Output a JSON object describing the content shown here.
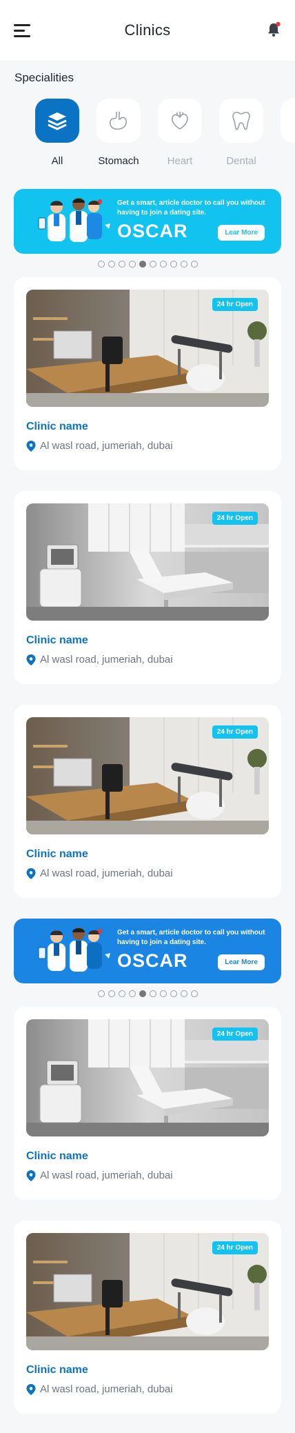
{
  "header": {
    "title": "Clinics"
  },
  "specialities": {
    "title": "Specialities",
    "items": [
      {
        "label": "All",
        "icon": "layers-icon"
      },
      {
        "label": "Stomach",
        "icon": "stomach-icon"
      },
      {
        "label": "Heart",
        "icon": "heart-icon"
      },
      {
        "label": "Dental",
        "icon": "tooth-icon"
      }
    ]
  },
  "banners": [
    {
      "text": "Get a smart, article doctor to call you without having to join a dating site.",
      "brand": "OSCAR",
      "button": "Lear More",
      "color": "#12c2ef"
    },
    {
      "text": "Get a smart, article doctor to call you without having to join a dating site.",
      "brand": "OSCAR",
      "button": "Lear More",
      "color": "#1a85e2"
    }
  ],
  "clinics": [
    {
      "name": "Clinic name",
      "address": "Al wasl road, jumeriah, dubai",
      "badge": "24 hr Open",
      "photo": "office"
    },
    {
      "name": "Clinic name",
      "address": "Al wasl road, jumeriah, dubai",
      "badge": "24 hr Open",
      "photo": "treatment"
    },
    {
      "name": "Clinic name",
      "address": "Al wasl road, jumeriah, dubai",
      "badge": "24 hr Open",
      "photo": "office"
    },
    {
      "name": "Clinic name",
      "address": "Al wasl road, jumeriah, dubai",
      "badge": "24 hr Open",
      "photo": "treatment"
    },
    {
      "name": "Clinic name",
      "address": "Al wasl road, jumeriah, dubai",
      "badge": "24 hr Open",
      "photo": "office"
    }
  ],
  "carousel": {
    "dot_count": 10,
    "active_index": 4
  },
  "colors": {
    "accent": "#0b73c4",
    "badge": "#12c2ef",
    "notification": "#e53935"
  }
}
